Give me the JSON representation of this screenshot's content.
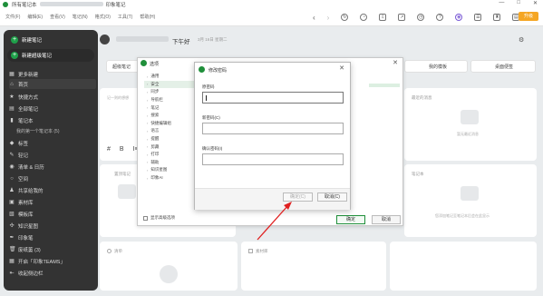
{
  "window": {
    "title": "所有笔记本",
    "app_name": "印象笔记",
    "controls": [
      "—",
      "□",
      "✕"
    ]
  },
  "menu": [
    "文件(F)",
    "编辑(E)",
    "查看(V)",
    "笔记(N)",
    "格式(O)",
    "工具(T)",
    "帮助(H)"
  ],
  "toolbar": {
    "icons": [
      "back-icon",
      "forward-icon",
      "sync-icon",
      "bell-icon",
      "export-icon",
      "share-icon",
      "clock-icon",
      "help-icon",
      "theme-icon",
      "chat-icon",
      "lab-icon",
      "note-icon"
    ],
    "upgrade_label": "升级"
  },
  "sidebar": {
    "new_note": "新建笔记",
    "new_super_note": "新建超级笔记",
    "items": [
      {
        "label": "更多新建",
        "icon": "grid"
      },
      {
        "label": "首页",
        "icon": "home"
      },
      {
        "label": "快捷方式",
        "icon": "star"
      },
      {
        "label": "全部笔记",
        "icon": "note"
      },
      {
        "label": "笔记本",
        "icon": "book"
      },
      {
        "label": "我的第一个笔记本 (5)",
        "icon": "",
        "sub": true
      },
      {
        "label": "标签",
        "icon": "tag"
      },
      {
        "label": "轻记",
        "icon": "bolt"
      },
      {
        "label": "清单 & 日历",
        "icon": "check"
      },
      {
        "label": "空间",
        "icon": "space"
      },
      {
        "label": "共享给我的",
        "icon": "share"
      },
      {
        "label": "素材库",
        "icon": "media"
      },
      {
        "label": "模板库",
        "icon": "template"
      },
      {
        "label": "知识星图",
        "icon": "graph"
      },
      {
        "label": "印象笔",
        "icon": "pen"
      },
      {
        "label": "废纸篓 (3)",
        "icon": "trash"
      },
      {
        "label": "开启「印象TEAMS」",
        "icon": "team"
      },
      {
        "label": "收起侧边栏",
        "icon": "collapse"
      }
    ]
  },
  "header": {
    "greeting": "下午好",
    "date": "3月 16日 星期二"
  },
  "main": {
    "quick_actions": [
      "超级笔记",
      "我的模板",
      "桌面便签"
    ],
    "cards": {
      "notes_title": "笔记",
      "notes_hint": "记一则的想想",
      "recent_title": "最近的消息",
      "recent_hint": "暂无最近消息",
      "pinned_title": "置顶笔记",
      "notebook_title": "笔记本",
      "notebook_hint": "您添加笔记至笔记本后会在此显示",
      "checklist_title": "清单",
      "media_title": "素材库"
    },
    "format_bar": [
      "#",
      "B",
      "I≡"
    ]
  },
  "prefs_dialog": {
    "title": "选项",
    "nav": [
      "通用",
      "安全",
      "同步",
      "导航栏",
      "笔记",
      "搜索",
      "快捷编辑组",
      "语言",
      "提醒",
      "剪藏",
      "打印",
      "辅助",
      "知识星图",
      "印象AI"
    ],
    "active_index": 1,
    "show_advanced": "显示高级选项",
    "ok": "确定",
    "cancel": "取消"
  },
  "password_dialog": {
    "title": "修改密码",
    "old_password_label": "原密码",
    "new_password_label": "新密码(C)",
    "confirm_password_label": "确认密码(I)",
    "ok": "确定(C)",
    "cancel": "取消(C)"
  }
}
